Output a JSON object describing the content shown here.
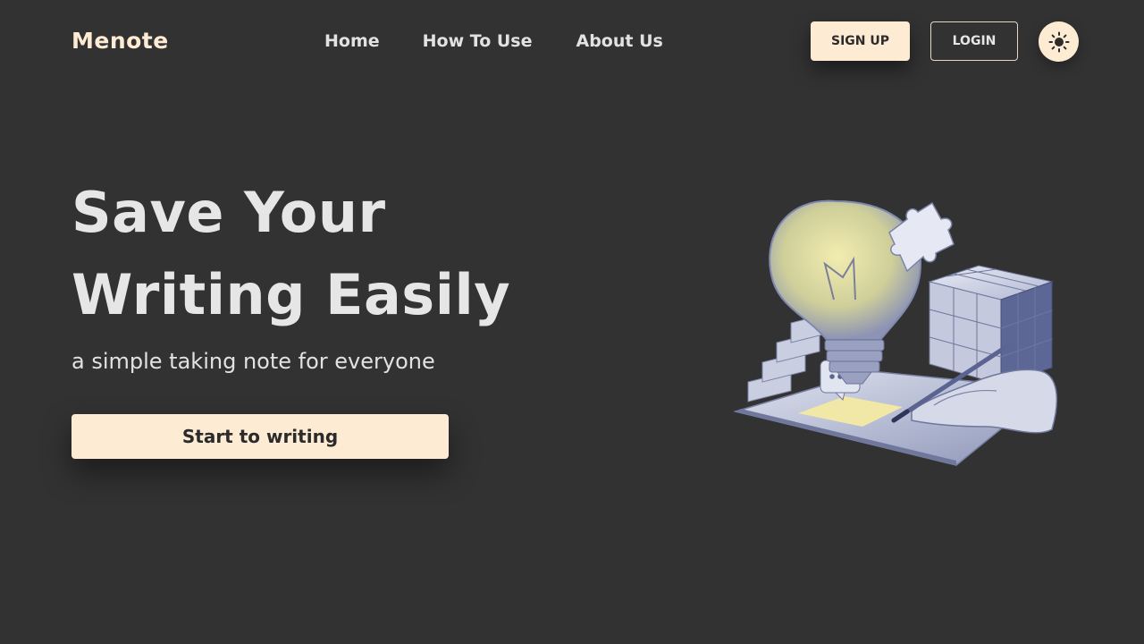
{
  "header": {
    "logo": "Menote",
    "nav": [
      {
        "label": "Home"
      },
      {
        "label": "How To Use"
      },
      {
        "label": "About Us"
      }
    ],
    "signup_label": "SIGN UP",
    "login_label": "LOGIN",
    "theme_icon": "sun-icon"
  },
  "hero": {
    "title_line1": "Save Your",
    "title_line2": "Writing Easily",
    "subtitle": "a simple taking note for everyone",
    "cta_label": "Start to writing",
    "illustration": "lightbulb-idea-illustration"
  },
  "colors": {
    "background": "#323232",
    "accent": "#feebd4",
    "text": "#e6e6e6"
  }
}
